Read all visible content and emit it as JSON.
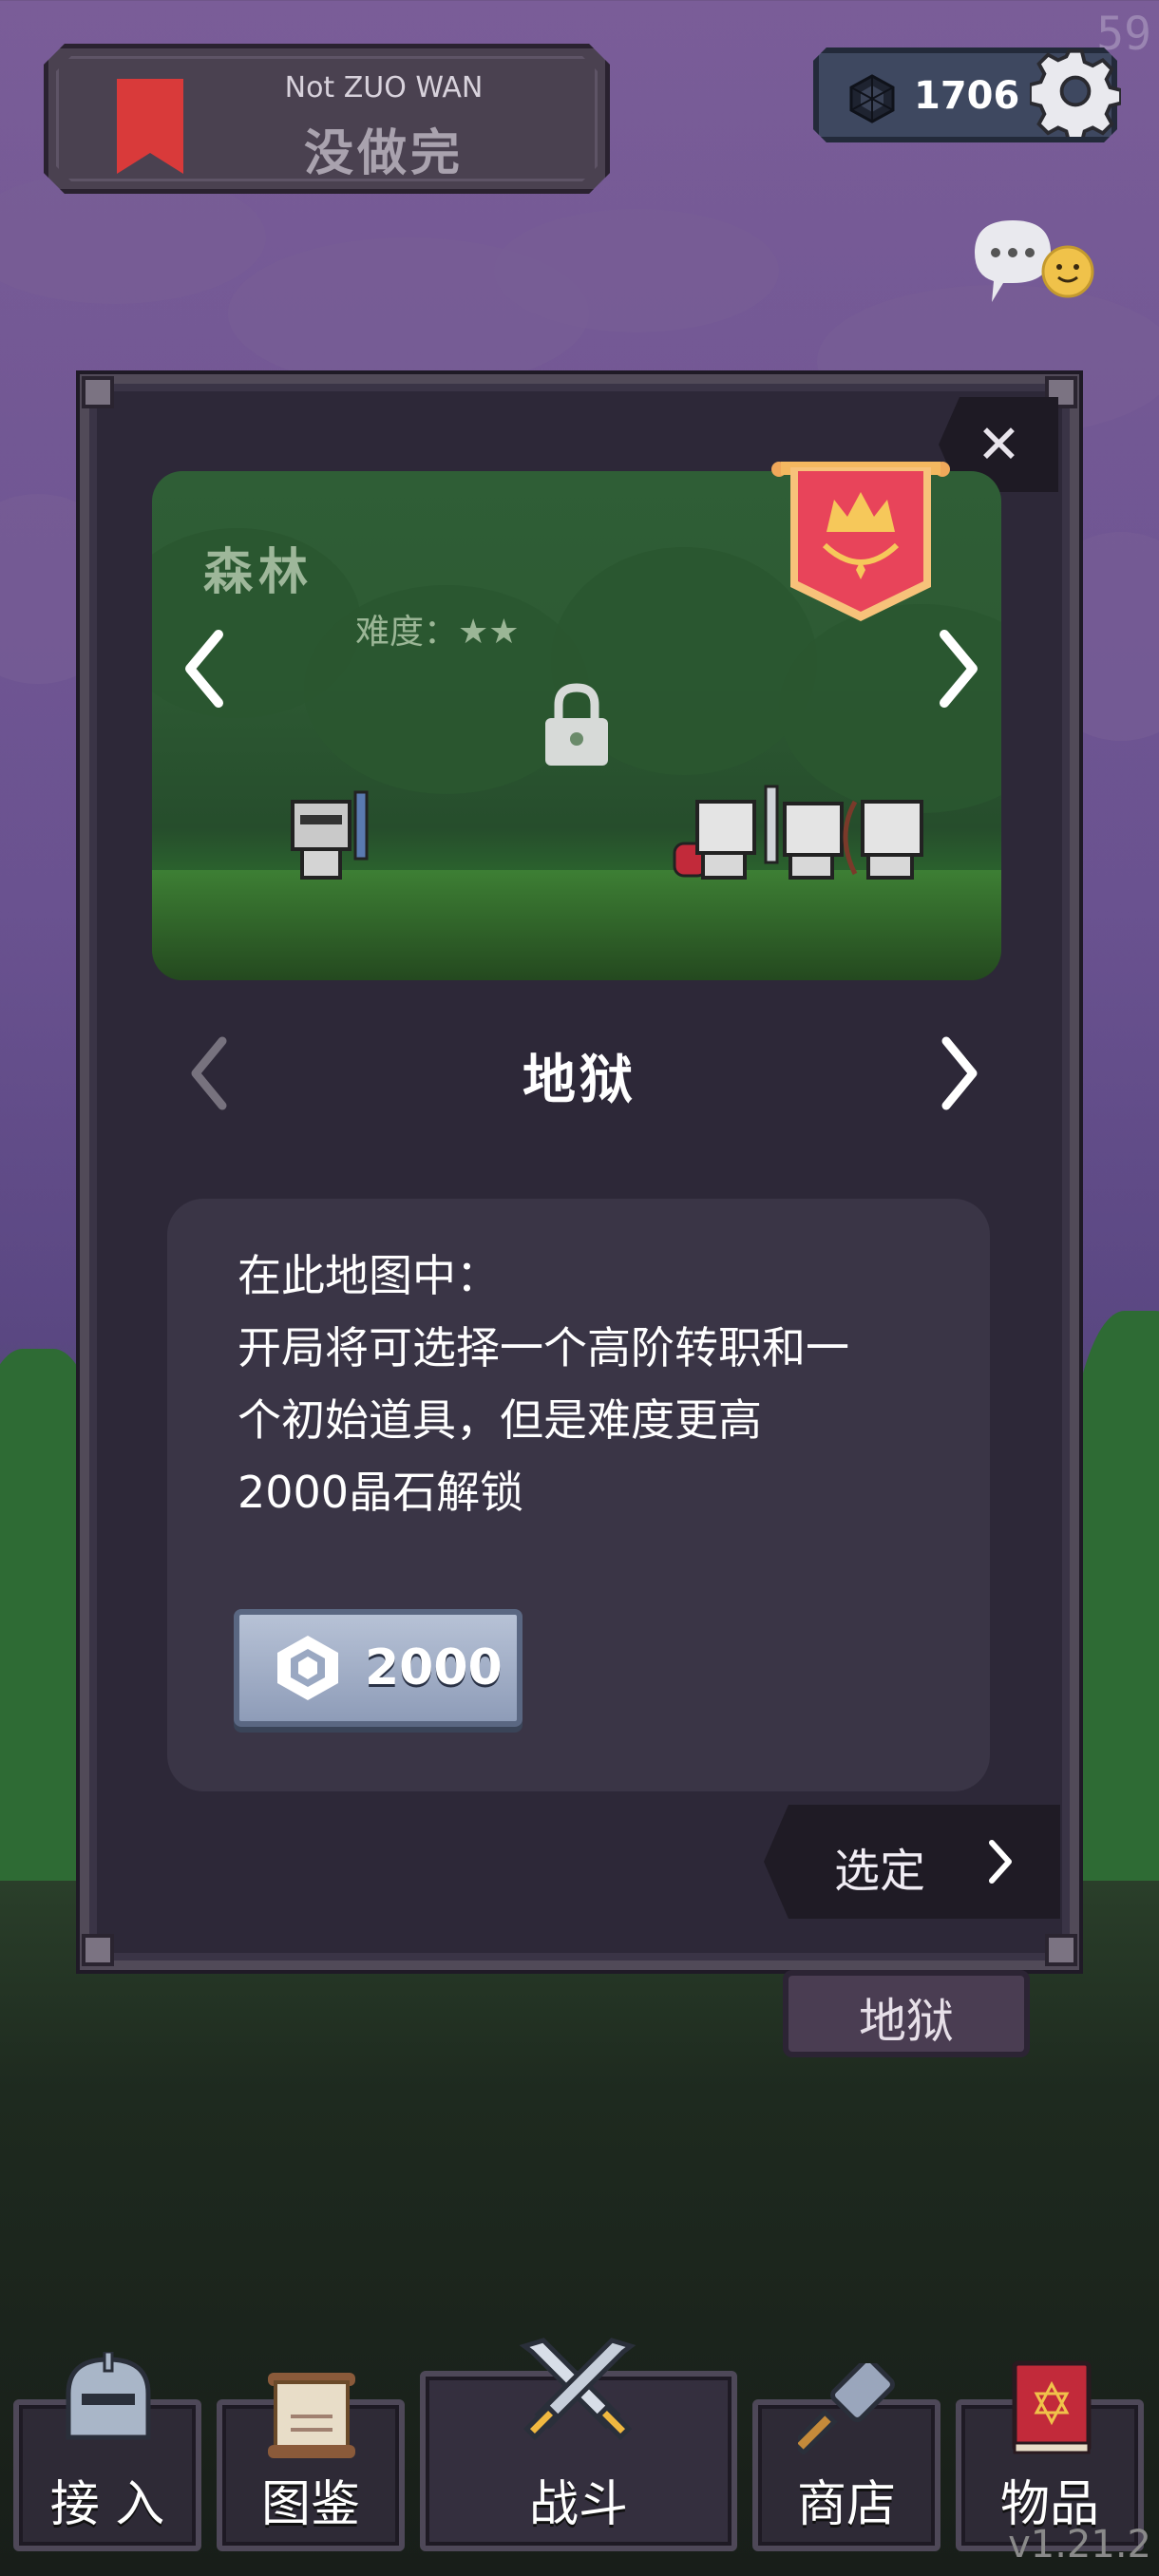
{
  "hud": {
    "fps": "59",
    "profile": {
      "name": "Not ZUO WAN",
      "status": "没做完"
    },
    "crystals": "1706",
    "version": "v1.21.2"
  },
  "modal": {
    "map": {
      "name": "森林",
      "difficulty_label": "难度：",
      "difficulty_stars": "★★",
      "locked": true
    },
    "mode": {
      "title": "地狱"
    },
    "description": {
      "lines": [
        "在此地图中：",
        "开局将可选择一个高阶转职和一",
        "个初始道具，但是难度更高",
        "2000晶石解锁"
      ]
    },
    "unlock_cost": "2000",
    "select_label": "选定"
  },
  "current_mode_tag": "地狱",
  "nav": {
    "items": [
      {
        "label": "接 入",
        "icon": "helmet-icon"
      },
      {
        "label": "图鉴",
        "icon": "scroll-icon"
      },
      {
        "label": "战斗",
        "icon": "crossed-swords-icon"
      },
      {
        "label": "商店",
        "icon": "hammer-icon"
      },
      {
        "label": "物品",
        "icon": "spellbook-icon"
      }
    ]
  },
  "colors": {
    "accent_red": "#d93a3a",
    "panel_bg": "#2d2838",
    "unlock_button": "#a9b6cc",
    "sky": "#7a5d98"
  }
}
